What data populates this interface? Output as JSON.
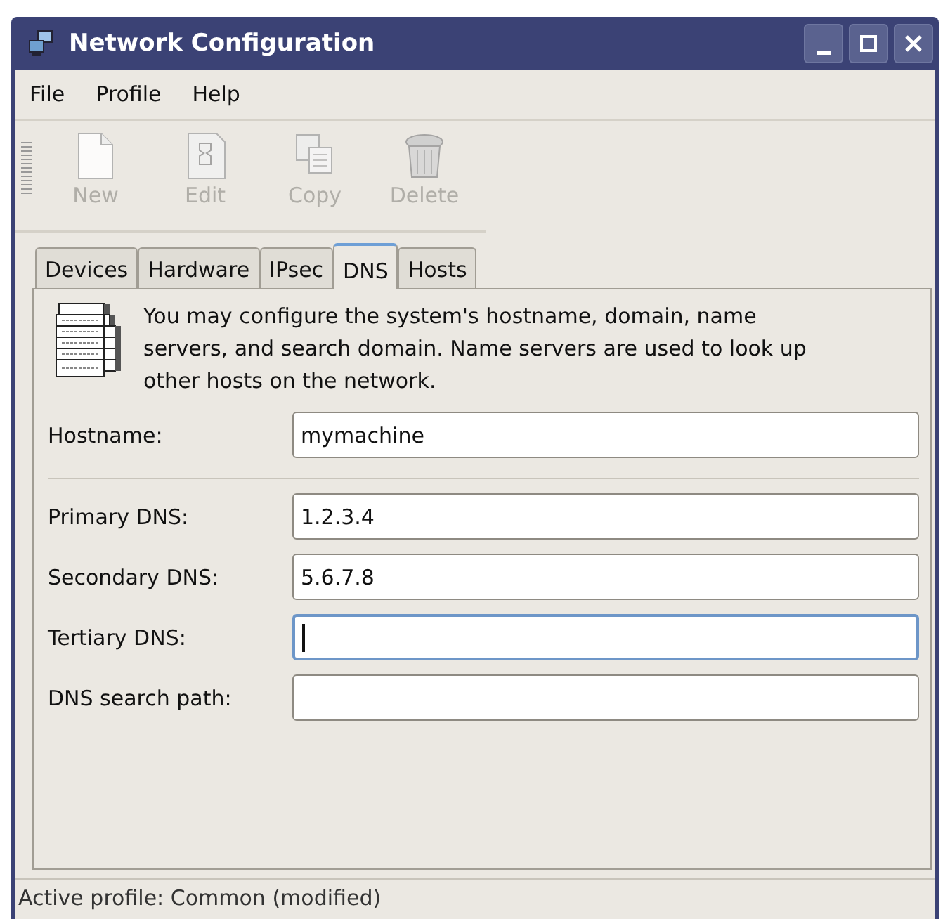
{
  "window": {
    "title": "Network Configuration"
  },
  "menu": [
    {
      "label": "File"
    },
    {
      "label": "Profile"
    },
    {
      "label": "Help"
    }
  ],
  "toolbar": [
    {
      "label": "New",
      "kind": "new",
      "disabled": true
    },
    {
      "label": "Edit",
      "kind": "edit",
      "disabled": true
    },
    {
      "label": "Copy",
      "kind": "copy",
      "disabled": true
    },
    {
      "label": "Delete",
      "kind": "delete",
      "disabled": true
    }
  ],
  "tabs": [
    {
      "label": "Devices",
      "selected": false
    },
    {
      "label": "Hardware",
      "selected": false
    },
    {
      "label": "IPsec",
      "selected": false
    },
    {
      "label": "DNS",
      "selected": true
    },
    {
      "label": "Hosts",
      "selected": false
    }
  ],
  "description": "You may configure the system's hostname, domain, name servers, and search domain. Name servers are used to look up other hosts on the network.",
  "fields": [
    {
      "kind": "entry",
      "label": "Hostname:",
      "value": "mymachine",
      "focused": false
    },
    {
      "kind": "separator"
    },
    {
      "kind": "entry",
      "label": "Primary DNS:",
      "value": "1.2.3.4",
      "focused": false
    },
    {
      "kind": "entry",
      "label": "Secondary DNS:",
      "value": "5.6.7.8",
      "focused": false
    },
    {
      "kind": "entry",
      "label": "Tertiary DNS:",
      "focused": true
    },
    {
      "kind": "entry",
      "label": "DNS search path:",
      "focused": false
    }
  ],
  "status_bar": "Active profile: Common (modified)"
}
